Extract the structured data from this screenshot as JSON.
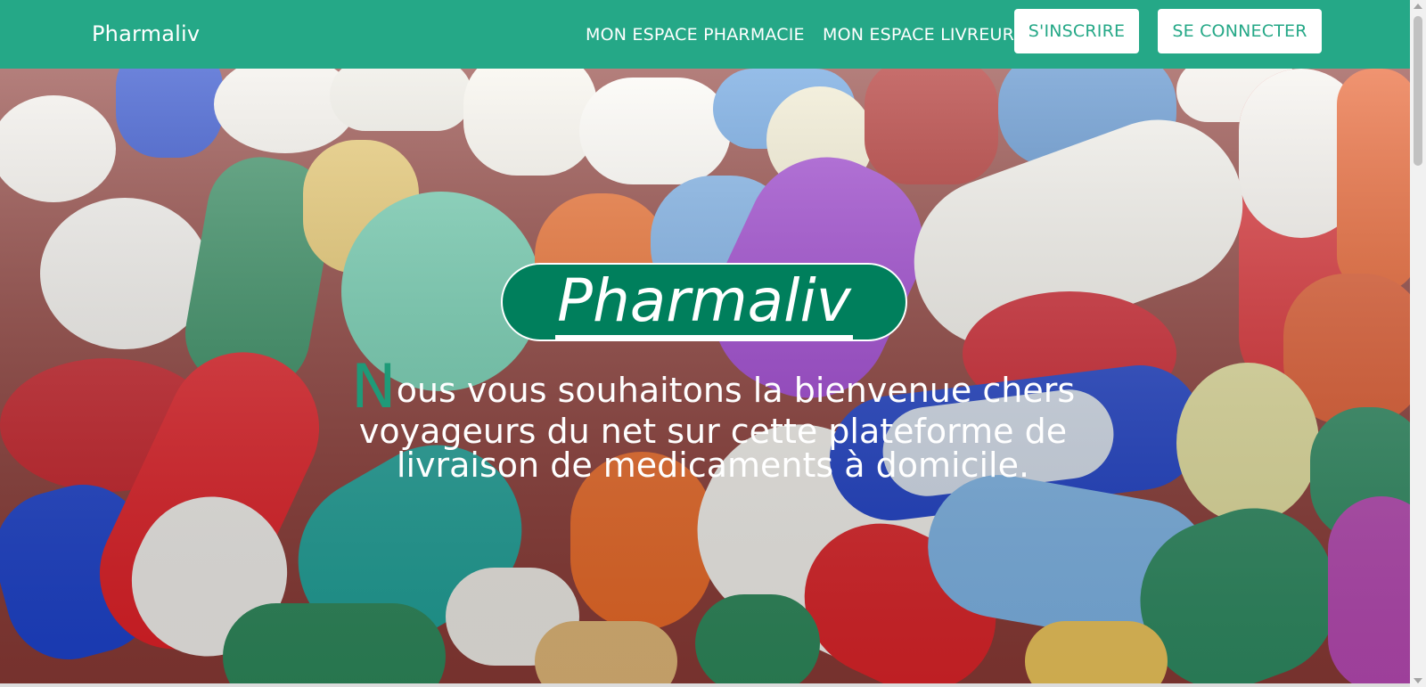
{
  "nav": {
    "brand": "Pharmaliv",
    "links": [
      "MON ESPACE PHARMACIE",
      "MON ESPACE LIVREUR"
    ],
    "signup_label": "S'INSCRIRE",
    "login_label": "SE CONNECTER"
  },
  "hero": {
    "title": "Pharmaliv",
    "welcome_dropcap": "N",
    "welcome_text": "ous vous souhaitons la bienvenue chers voyageurs du net sur cette plateforme de livraison de medicaments à domicile."
  },
  "colors": {
    "brand_green": "#25a887",
    "title_green": "#007f5c"
  }
}
